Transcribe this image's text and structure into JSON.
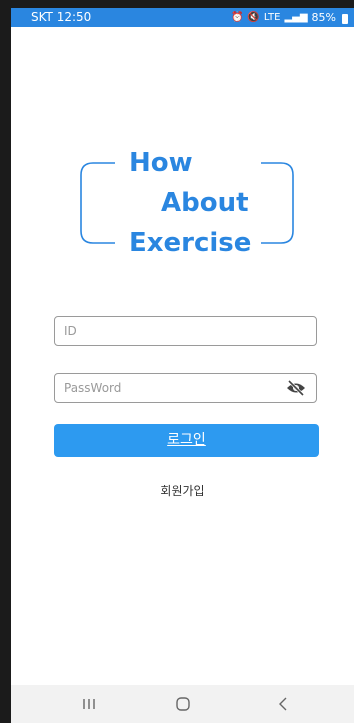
{
  "statusbar": {
    "carrier_time": "SKT 12:50",
    "network": "LTE",
    "battery": "85%"
  },
  "logo": {
    "line1": "How",
    "line2": "About",
    "line3": "Exercise"
  },
  "form": {
    "id_placeholder": "ID",
    "password_placeholder": "PassWord",
    "login_label": "로그인",
    "signup_label": "회원가입"
  },
  "colors": {
    "accent": "#2a86e0",
    "button": "#2d9af0",
    "navbar": "#f2f2f2"
  },
  "icons": {
    "eye_toggle": "eye-off-icon",
    "nav_recent": "recent-apps-icon",
    "nav_home": "home-icon",
    "nav_back": "back-icon"
  }
}
